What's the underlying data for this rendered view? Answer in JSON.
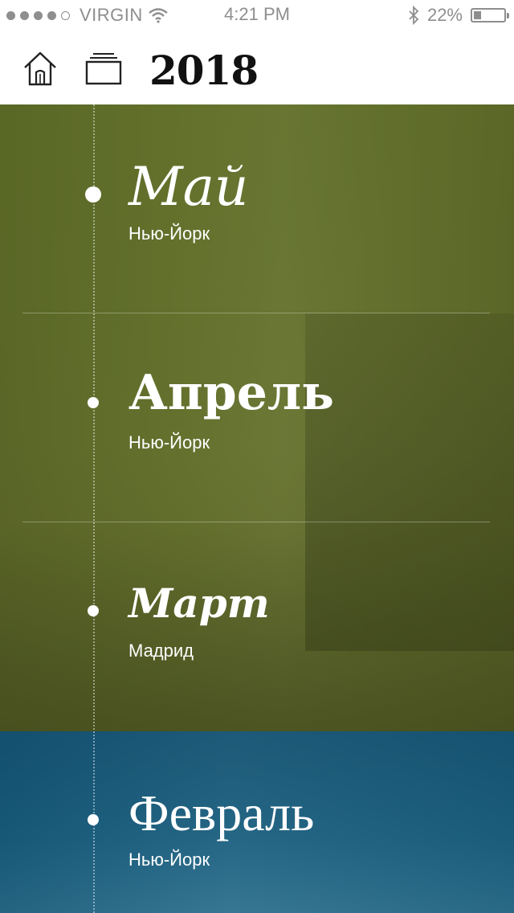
{
  "status_bar": {
    "carrier": "VIRGIN",
    "time": "4:21 PM",
    "battery": "22%",
    "battery_level": 0.22,
    "signal_bars": 4
  },
  "header": {
    "title": "2018",
    "home_icon": "home-icon",
    "stack_icon": "cards-stack-icon"
  },
  "timeline": [
    {
      "month": "Май",
      "city": "Нью-Йорк"
    },
    {
      "month": "Апрель",
      "city": "Нью-Йорк"
    },
    {
      "month": "Март",
      "city": "Мадрид"
    },
    {
      "month": "Февраль",
      "city": "Нью-Йорк"
    }
  ],
  "colors": {
    "green_overlay": "#606e28",
    "blue_overlay": "#125070",
    "text": "#ffffff"
  }
}
